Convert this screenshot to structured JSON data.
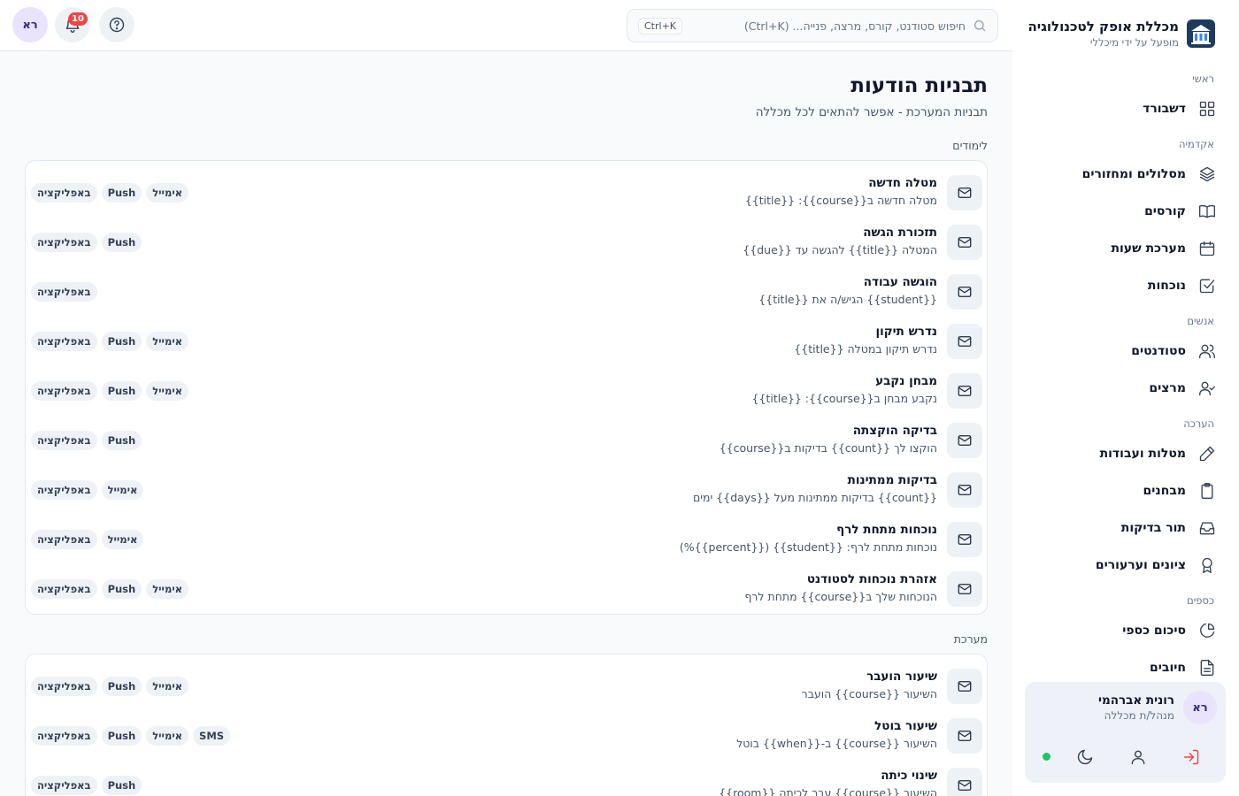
{
  "brand": {
    "name": "מכללת אופק לטכנולוגיה",
    "subtitle": "מופעל על ידי מיכללי"
  },
  "sidebar": {
    "sections": [
      {
        "title": "ראשי",
        "items": [
          {
            "label": "דשבורד",
            "icon": "dashboard-grid-icon"
          }
        ]
      },
      {
        "title": "אקדמיה",
        "items": [
          {
            "label": "מסלולים ומחזורים",
            "icon": "layers-icon"
          },
          {
            "label": "קורסים",
            "icon": "book-icon"
          },
          {
            "label": "מערכת שעות",
            "icon": "calendar-icon"
          },
          {
            "label": "נוכחות",
            "icon": "check-square-icon"
          }
        ]
      },
      {
        "title": "אנשים",
        "items": [
          {
            "label": "סטודנטים",
            "icon": "users-icon"
          },
          {
            "label": "מרצים",
            "icon": "user-check-icon"
          }
        ]
      },
      {
        "title": "הערכה",
        "items": [
          {
            "label": "מטלות ועבודות",
            "icon": "pencil-icon"
          },
          {
            "label": "מבחנים",
            "icon": "clipboard-icon"
          },
          {
            "label": "תור בדיקות",
            "icon": "inbox-icon"
          },
          {
            "label": "ציונים וערעורים",
            "icon": "award-icon"
          }
        ]
      },
      {
        "title": "כספים",
        "items": [
          {
            "label": "סיכום כספי",
            "icon": "pie-chart-icon"
          },
          {
            "label": "חיובים",
            "icon": "file-text-icon"
          }
        ]
      }
    ]
  },
  "user": {
    "initials": "רא",
    "name": "רונית אברהמי",
    "role": "מנהל/ת מכללה",
    "status_color": "#22c55e"
  },
  "topbar": {
    "search_placeholder": "חיפוש סטודנט, קורס, מרצה, פנייה... (Ctrl+K)",
    "shortcut": "Ctrl+K",
    "notifications_count": "10",
    "avatar_initials": "רא"
  },
  "page": {
    "title": "תבניות הודעות",
    "subtitle": "תבניות המערכת - אפשר להתאים לכל מכללה"
  },
  "groups": [
    {
      "label": "לימודים",
      "templates": [
        {
          "name": "מטלה חדשה",
          "body": "מטלה חדשה ב{{course}}: {{title}}",
          "channels": [
            "באפליקציה",
            "Push",
            "אימייל"
          ]
        },
        {
          "name": "תזכורת הגשה",
          "body": "המטלה {{title}} להגשה עד {{due}}",
          "channels": [
            "באפליקציה",
            "Push"
          ]
        },
        {
          "name": "הוגשה עבודה",
          "body": "{{student}} הגיש/ה את {{title}}",
          "channels": [
            "באפליקציה"
          ]
        },
        {
          "name": "נדרש תיקון",
          "body": "נדרש תיקון במטלה {{title}}",
          "channels": [
            "באפליקציה",
            "Push",
            "אימייל"
          ]
        },
        {
          "name": "מבחן נקבע",
          "body": "נקבע מבחן ב{{course}}: {{title}}",
          "channels": [
            "באפליקציה",
            "Push",
            "אימייל"
          ]
        },
        {
          "name": "בדיקה הוקצתה",
          "body": "הוקצו לך {{count}} בדיקות ב{{course}}",
          "channels": [
            "באפליקציה",
            "Push"
          ]
        },
        {
          "name": "בדיקות ממתינות",
          "body": "{{count}} בדיקות ממתינות מעל {{days}} ימים",
          "channels": [
            "באפליקציה",
            "אימייל"
          ]
        },
        {
          "name": "נוכחות מתחת לרף",
          "body": "נוכחות מתחת לרף: {{student}} ({{percent}}%)",
          "channels": [
            "באפליקציה",
            "אימייל"
          ]
        },
        {
          "name": "אזהרת נוכחות לסטודנט",
          "body": "הנוכחות שלך ב{{course}} מתחת לרף",
          "channels": [
            "באפליקציה",
            "Push",
            "אימייל"
          ]
        }
      ]
    },
    {
      "label": "מערכת",
      "templates": [
        {
          "name": "שיעור הועבר",
          "body": "השיעור {{course}} הועבר",
          "channels": [
            "באפליקציה",
            "Push",
            "אימייל"
          ]
        },
        {
          "name": "שיעור בוטל",
          "body": "השיעור {{course}} ב-{{when}} בוטל",
          "channels": [
            "באפליקציה",
            "Push",
            "אימייל",
            "SMS"
          ]
        },
        {
          "name": "שינוי כיתה",
          "body": "השיעור {{course}} עבר לכיתה {{room}}",
          "channels": [
            "באפליקציה",
            "Push"
          ]
        }
      ]
    }
  ]
}
